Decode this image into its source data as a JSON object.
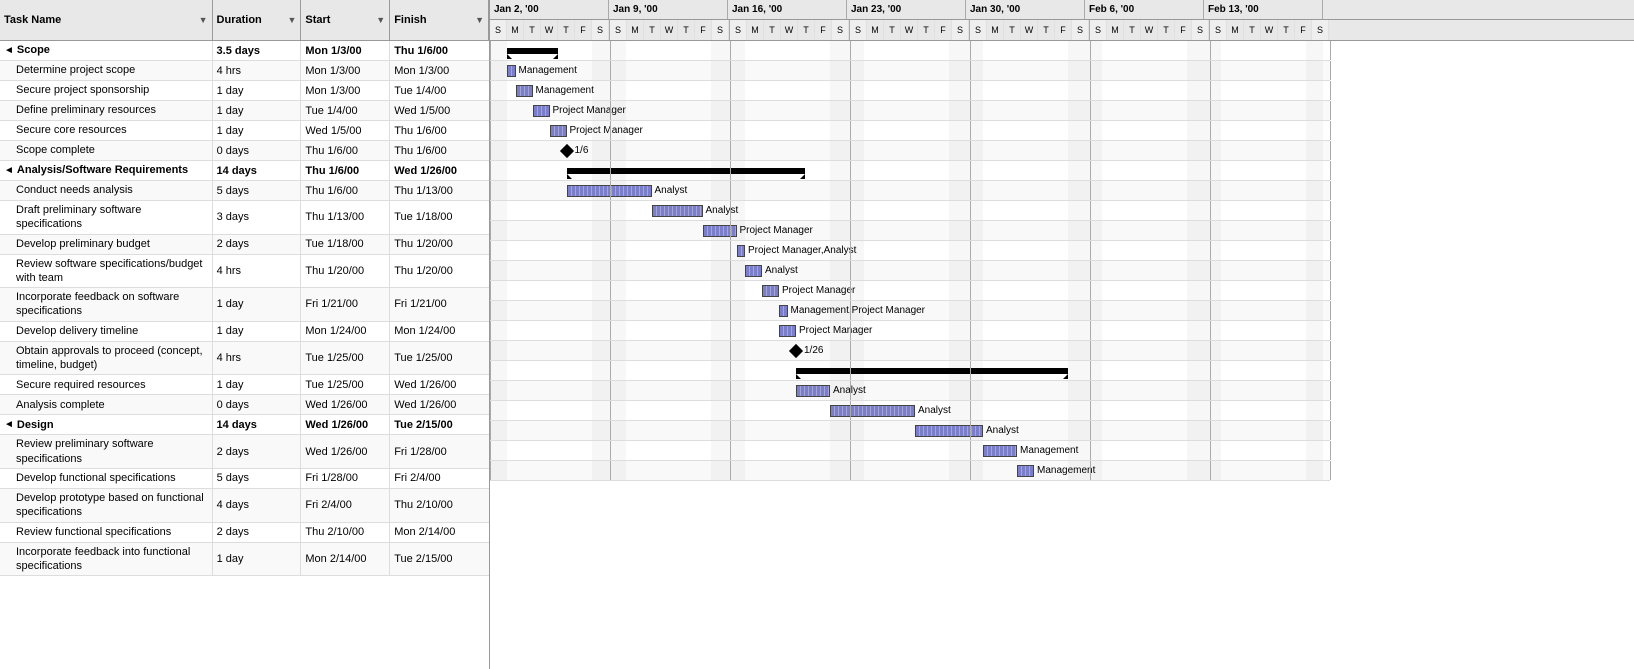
{
  "header": {
    "columns": [
      "Task Name",
      "Duration",
      "Start",
      "Finish"
    ]
  },
  "tasks": [
    {
      "id": 1,
      "level": 0,
      "group": true,
      "name": "Scope",
      "duration": "3.5 days",
      "start": "Mon 1/3/00",
      "finish": "Thu 1/6/00",
      "bold": true
    },
    {
      "id": 2,
      "level": 1,
      "group": false,
      "name": "Determine project scope",
      "duration": "4 hrs",
      "start": "Mon 1/3/00",
      "finish": "Mon 1/3/00"
    },
    {
      "id": 3,
      "level": 1,
      "group": false,
      "name": "Secure project sponsorship",
      "duration": "1 day",
      "start": "Mon 1/3/00",
      "finish": "Tue 1/4/00"
    },
    {
      "id": 4,
      "level": 1,
      "group": false,
      "name": "Define preliminary resources",
      "duration": "1 day",
      "start": "Tue 1/4/00",
      "finish": "Wed 1/5/00"
    },
    {
      "id": 5,
      "level": 1,
      "group": false,
      "name": "Secure core resources",
      "duration": "1 day",
      "start": "Wed 1/5/00",
      "finish": "Thu 1/6/00"
    },
    {
      "id": 6,
      "level": 1,
      "group": false,
      "name": "Scope complete",
      "duration": "0 days",
      "start": "Thu 1/6/00",
      "finish": "Thu 1/6/00"
    },
    {
      "id": 7,
      "level": 0,
      "group": true,
      "name": "Analysis/Software Requirements",
      "duration": "14 days",
      "start": "Thu 1/6/00",
      "finish": "Wed 1/26/00",
      "bold": true
    },
    {
      "id": 8,
      "level": 1,
      "group": false,
      "name": "Conduct needs analysis",
      "duration": "5 days",
      "start": "Thu 1/6/00",
      "finish": "Thu 1/13/00"
    },
    {
      "id": 9,
      "level": 1,
      "group": false,
      "name": "Draft preliminary software specifications",
      "duration": "3 days",
      "start": "Thu 1/13/00",
      "finish": "Tue 1/18/00"
    },
    {
      "id": 10,
      "level": 1,
      "group": false,
      "name": "Develop preliminary budget",
      "duration": "2 days",
      "start": "Tue 1/18/00",
      "finish": "Thu 1/20/00"
    },
    {
      "id": 11,
      "level": 1,
      "group": false,
      "name": "Review software specifications/budget with team",
      "duration": "4 hrs",
      "start": "Thu 1/20/00",
      "finish": "Thu 1/20/00"
    },
    {
      "id": 12,
      "level": 1,
      "group": false,
      "name": "Incorporate feedback on software specifications",
      "duration": "1 day",
      "start": "Fri 1/21/00",
      "finish": "Fri 1/21/00"
    },
    {
      "id": 13,
      "level": 1,
      "group": false,
      "name": "Develop delivery timeline",
      "duration": "1 day",
      "start": "Mon 1/24/00",
      "finish": "Mon 1/24/00"
    },
    {
      "id": 14,
      "level": 1,
      "group": false,
      "name": "Obtain approvals to proceed (concept, timeline, budget)",
      "duration": "4 hrs",
      "start": "Tue 1/25/00",
      "finish": "Tue 1/25/00"
    },
    {
      "id": 15,
      "level": 1,
      "group": false,
      "name": "Secure required resources",
      "duration": "1 day",
      "start": "Tue 1/25/00",
      "finish": "Wed 1/26/00"
    },
    {
      "id": 16,
      "level": 1,
      "group": false,
      "name": "Analysis complete",
      "duration": "0 days",
      "start": "Wed 1/26/00",
      "finish": "Wed 1/26/00"
    },
    {
      "id": 17,
      "level": 0,
      "group": true,
      "name": "Design",
      "duration": "14 days",
      "start": "Wed 1/26/00",
      "finish": "Tue 2/15/00",
      "bold": true
    },
    {
      "id": 18,
      "level": 1,
      "group": false,
      "name": "Review preliminary software specifications",
      "duration": "2 days",
      "start": "Wed 1/26/00",
      "finish": "Fri 1/28/00"
    },
    {
      "id": 19,
      "level": 1,
      "group": false,
      "name": "Develop functional specifications",
      "duration": "5 days",
      "start": "Fri 1/28/00",
      "finish": "Fri 2/4/00"
    },
    {
      "id": 20,
      "level": 1,
      "group": false,
      "name": "Develop prototype based on functional specifications",
      "duration": "4 days",
      "start": "Fri 2/4/00",
      "finish": "Thu 2/10/00"
    },
    {
      "id": 21,
      "level": 1,
      "group": false,
      "name": "Review functional specifications",
      "duration": "2 days",
      "start": "Thu 2/10/00",
      "finish": "Mon 2/14/00"
    },
    {
      "id": 22,
      "level": 1,
      "group": false,
      "name": "Incorporate feedback into functional specifications",
      "duration": "1 day",
      "start": "Mon 2/14/00",
      "finish": "Tue 2/15/00"
    }
  ],
  "gantt": {
    "weeks": [
      {
        "label": "Jan 2, '00",
        "days": [
          "S",
          "M",
          "T",
          "W",
          "T",
          "F",
          "S"
        ]
      },
      {
        "label": "Jan 9, '00",
        "days": [
          "S",
          "M",
          "T",
          "W",
          "T",
          "F",
          "S"
        ]
      },
      {
        "label": "Jan 16, '00",
        "days": [
          "S",
          "M",
          "T",
          "W",
          "T",
          "F",
          "S"
        ]
      },
      {
        "label": "Jan 23, '00",
        "days": [
          "S",
          "M",
          "T",
          "W",
          "T",
          "F",
          "S"
        ]
      },
      {
        "label": "Jan 30, '00",
        "days": [
          "S",
          "M",
          "T",
          "W",
          "T",
          "F",
          "S"
        ]
      },
      {
        "label": "Feb 6, '00",
        "days": [
          "S",
          "M",
          "T",
          "W",
          "T",
          "F",
          "S"
        ]
      },
      {
        "label": "Feb 13, '00",
        "days": [
          "S",
          "M",
          "T",
          "W",
          "T",
          "F",
          "S"
        ]
      }
    ],
    "bars": [
      {
        "row": 0,
        "type": "summary",
        "startDay": 1,
        "endDay": 4,
        "label": ""
      },
      {
        "row": 1,
        "type": "task",
        "startDay": 1,
        "width": 1,
        "label": "Management"
      },
      {
        "row": 2,
        "type": "task",
        "startDay": 1,
        "width": 1,
        "label": "Management"
      },
      {
        "row": 3,
        "type": "task",
        "startDay": 2,
        "width": 1,
        "label": "Project Manager"
      },
      {
        "row": 4,
        "type": "task",
        "startDay": 3,
        "width": 1,
        "label": "Project Manager"
      },
      {
        "row": 5,
        "type": "milestone",
        "startDay": 4,
        "label": "1/6"
      },
      {
        "row": 6,
        "type": "summary",
        "startDay": 4,
        "endDay": 18,
        "label": ""
      },
      {
        "row": 7,
        "type": "task",
        "startDay": 4,
        "width": 5,
        "label": "Analyst"
      },
      {
        "row": 8,
        "type": "task",
        "startDay": 9,
        "width": 3,
        "label": "Analyst"
      },
      {
        "row": 9,
        "type": "task",
        "startDay": 12,
        "width": 2,
        "label": "Project Manager"
      },
      {
        "row": 10,
        "type": "task",
        "startDay": 14,
        "width": 0.5,
        "label": "Project Manager,Analyst"
      },
      {
        "row": 11,
        "type": "task",
        "startDay": 15,
        "width": 1,
        "label": "Analyst"
      },
      {
        "row": 12,
        "type": "task",
        "startDay": 16,
        "width": 1,
        "label": "Project Manager"
      },
      {
        "row": 13,
        "type": "task",
        "startDay": 17,
        "width": 0.5,
        "label": "Management,Project Manager"
      },
      {
        "row": 14,
        "type": "task",
        "startDay": 17,
        "width": 1,
        "label": "Project Manager"
      },
      {
        "row": 15,
        "type": "milestone",
        "startDay": 18,
        "label": "1/26"
      },
      {
        "row": 16,
        "type": "summary",
        "startDay": 18,
        "endDay": 34,
        "label": ""
      },
      {
        "row": 17,
        "type": "task",
        "startDay": 18,
        "width": 2,
        "label": "Analyst"
      },
      {
        "row": 18,
        "type": "task",
        "startDay": 20,
        "width": 5,
        "label": "Analyst"
      },
      {
        "row": 19,
        "type": "task",
        "startDay": 25,
        "width": 4,
        "label": "Analyst"
      },
      {
        "row": 20,
        "type": "task",
        "startDay": 29,
        "width": 2,
        "label": "Management"
      },
      {
        "row": 21,
        "type": "task",
        "startDay": 31,
        "width": 1,
        "label": "Management"
      }
    ]
  }
}
